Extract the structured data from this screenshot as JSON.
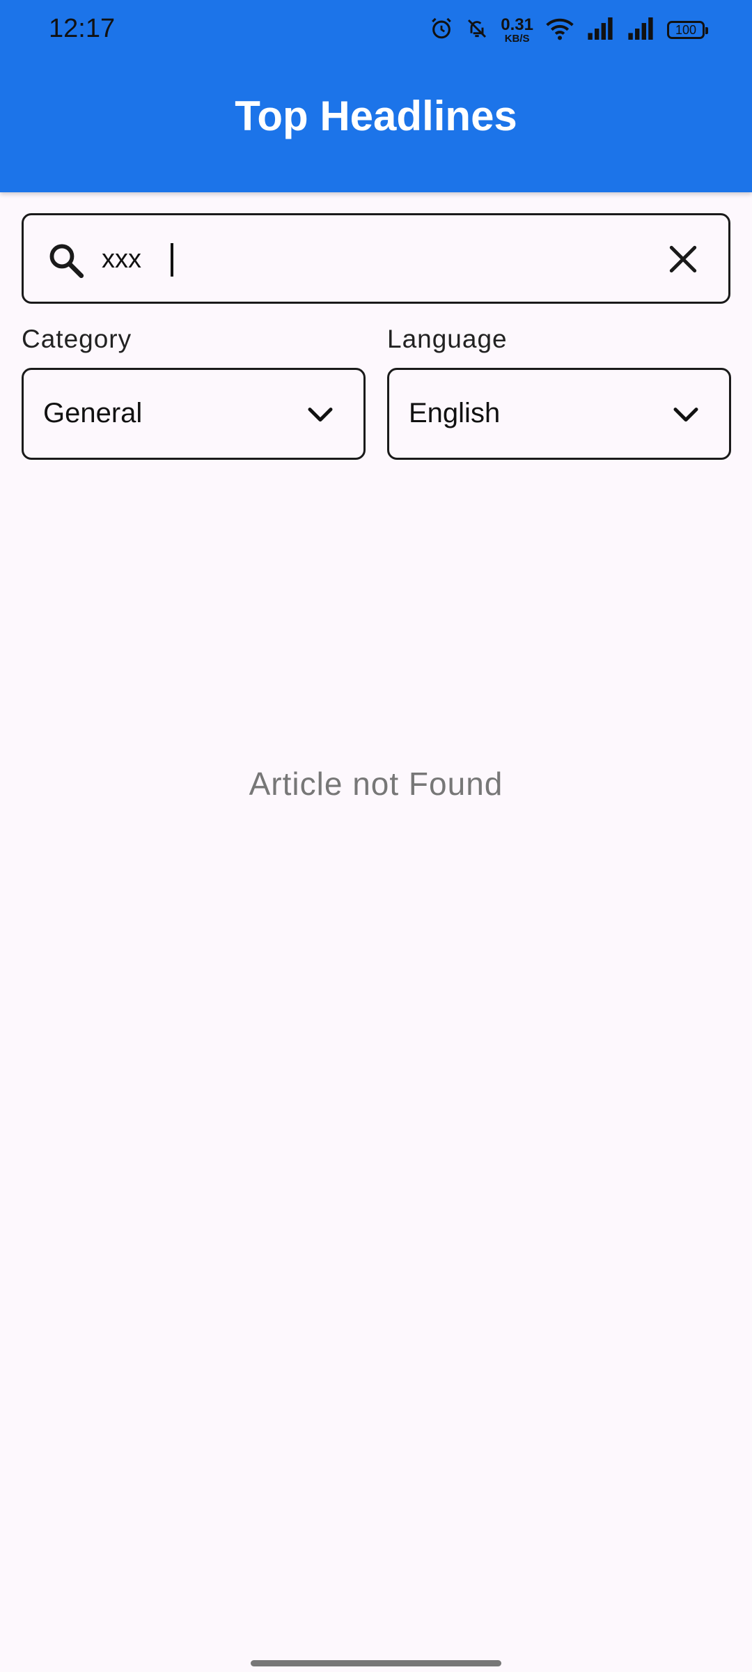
{
  "status_bar": {
    "time": "12:17",
    "net_speed_value": "0.31",
    "net_speed_unit": "KB/S",
    "battery": "100",
    "icons": [
      "alarm-icon",
      "bell-off-icon",
      "wifi-icon",
      "signal-icon",
      "signal-icon",
      "battery-icon"
    ]
  },
  "app_bar": {
    "title": "Top Headlines",
    "color": "#1c74e9"
  },
  "search": {
    "value": "xxx",
    "icon": "search-icon",
    "clear_icon": "close-icon"
  },
  "filters": {
    "category": {
      "label": "Category",
      "selected": "General"
    },
    "language": {
      "label": "Language",
      "selected": "English"
    }
  },
  "main": {
    "empty_message": "Article not Found"
  }
}
